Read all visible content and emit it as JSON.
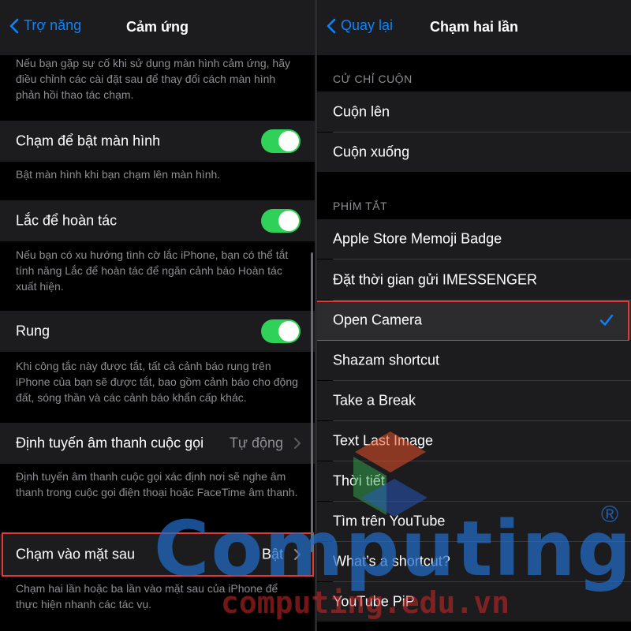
{
  "left_screen": {
    "back_label": "Trợ năng",
    "title": "Cảm ứng",
    "intro_note": "Nếu bạn gặp sự cố khi sử dụng màn hình cảm ứng, hãy điều chỉnh các cài đặt sau để thay đổi cách màn hình phản hồi thao tác chạm.",
    "rows": [
      {
        "label": "Chạm để bật màn hình",
        "toggle_on": true,
        "note": "Bật màn hình khi bạn chạm lên màn hình."
      },
      {
        "label": "Lắc để hoàn tác",
        "toggle_on": true,
        "note": "Nếu bạn có xu hướng tình cờ lắc iPhone, bạn có thể tắt tính năng Lắc để hoàn tác để ngăn cảnh báo Hoàn tác xuất hiện."
      },
      {
        "label": "Rung",
        "toggle_on": true,
        "note": "Khi công tắc này được tắt, tất cả cảnh báo rung trên iPhone của bạn sẽ được tắt, bao gồm cảnh báo cho động đất, sóng thần và các cảnh báo khẩn cấp khác."
      },
      {
        "label": "Định tuyến âm thanh cuộc gọi",
        "value": "Tự động",
        "note": "Định tuyến âm thanh cuộc gọi xác định nơi sẽ nghe âm thanh trong cuộc gọi điện thoại hoặc FaceTime âm thanh."
      },
      {
        "label": "Chạm vào mặt sau",
        "value": "Bật",
        "note": "Chạm hai lần hoặc ba lần vào mặt sau của iPhone để thực hiện nhanh các tác vụ."
      }
    ]
  },
  "right_screen": {
    "back_label": "Quay lại",
    "title": "Chạm hai lần",
    "scroll_section": {
      "header": "CỬ CHỈ CUỘN",
      "items": [
        "Cuộn lên",
        "Cuộn xuống"
      ]
    },
    "shortcut_section": {
      "header": "PHÍM TẮT",
      "items": [
        "Apple Store Memoji Badge",
        "Đặt thời gian gửi IMESSENGER",
        "Open Camera",
        "Shazam shortcut",
        "Take a Break",
        "Text Last Image",
        "Thời tiết",
        "Tìm trên YouTube",
        "What’s a shortcut?",
        "YouTube PiP"
      ],
      "selected": "Open Camera"
    }
  },
  "watermark": {
    "word": "Computing",
    "url": "computing.edu.vn",
    "mark": "®"
  },
  "colors": {
    "accent_blue": "#0a84ff",
    "toggle_green": "#30d158",
    "highlight_red": "#e53935",
    "cell_bg": "#1c1c1e",
    "secondary_text": "#8e8e93"
  }
}
